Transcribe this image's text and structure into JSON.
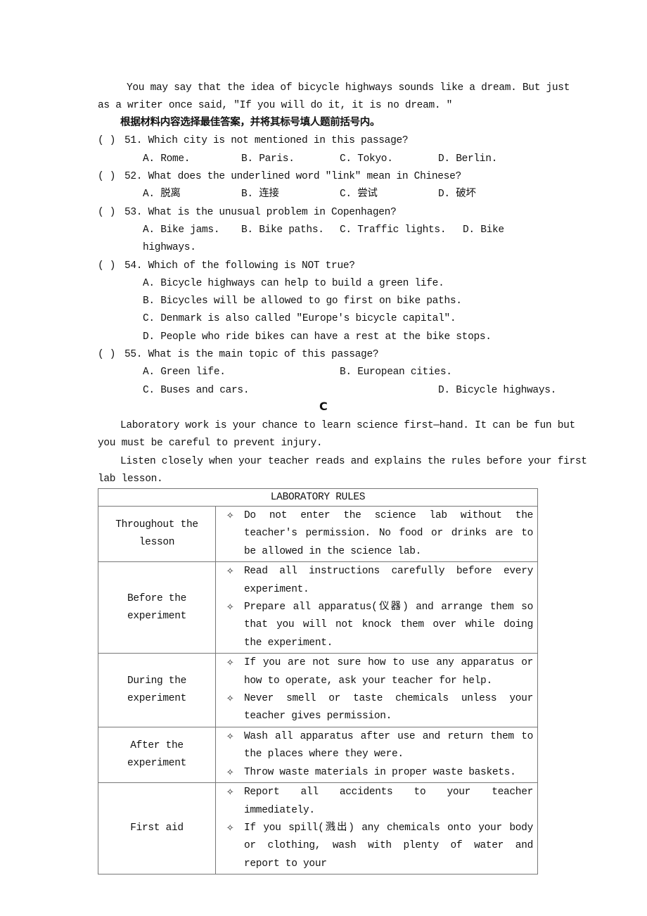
{
  "passage_end": {
    "line1": "You may say that the idea of bicycle highways sounds like a dream. But just",
    "line2": "as a writer once said, \"If you will do it, it is no dream. \""
  },
  "instructions": "根据材料内容选择最佳答案，并将其标号填人题前括号内。",
  "questions": [
    {
      "blank": "(    )",
      "stem": "51. Which city is not mentioned in this passage?",
      "options": [
        "A. Rome.",
        "B. Paris.",
        "C. Tokyo.",
        "D. Berlin."
      ]
    },
    {
      "blank": "(    )",
      "stem": "52. What does the underlined word \"link\" mean in Chinese?",
      "options": [
        "A. 脱离",
        "B. 连接",
        "C. 尝试",
        "D. 破坏"
      ]
    },
    {
      "blank": "(    )",
      "stem": "53. What is the unusual problem in Copenhagen?",
      "options": [
        "A. Bike jams.",
        "B. Bike paths.",
        "C. Traffic lights.",
        "D. Bike"
      ],
      "option_continuation": "highways."
    },
    {
      "blank": "(    )",
      "stem": "54. Which of the following is NOT true?",
      "options": [
        "A. Bicycle highways can help to build a green life.",
        "B. Bicycles will be allowed to go first on bike paths.",
        "C. Denmark is also called \"Europe's bicycle capital\".",
        "D. People who ride bikes can have a rest at the bike stops."
      ]
    },
    {
      "blank": "(    )",
      "stem": "55. What is the main topic of this passage?",
      "options": [
        "A. Green life.",
        "B. European cities.",
        "C. Buses and cars.",
        "D. Bicycle highways."
      ]
    }
  ],
  "section_c": {
    "heading": "C",
    "para1_line1": "Laboratory work is your chance to learn science first—hand. It can be fun but",
    "para1_line2": "you must be careful to prevent injury.",
    "para2_line1": "Listen closely when your teacher reads and explains the rules before your first",
    "para2_line2": "lab lesson."
  },
  "table": {
    "title": "LABORATORY RULES",
    "bullet_icon": "✧",
    "rows": [
      {
        "phase": [
          "Throughout the",
          "lesson"
        ],
        "rules": [
          "Do not enter the science lab without the teacher's permission. No food or drinks are to be allowed in the science lab."
        ]
      },
      {
        "phase": [
          "Before the",
          "experiment"
        ],
        "rules": [
          "Read all instructions carefully before every experiment.",
          "Prepare all apparatus(仪器) and arrange them so that you will not knock them over while doing the experiment."
        ]
      },
      {
        "phase": [
          "During the",
          "experiment"
        ],
        "rules": [
          "If you are not sure how to use any apparatus or how to operate, ask your teacher for help.",
          "Never smell or taste chemicals unless your teacher gives permission."
        ]
      },
      {
        "phase": [
          "After the",
          "experiment"
        ],
        "rules": [
          "Wash all apparatus after use and return them to the places where they were.",
          "Throw waste materials in proper waste baskets."
        ]
      },
      {
        "phase": [
          "First aid"
        ],
        "rules": [
          "Report all accidents to your teacher immediately.",
          "If you spill(溅出) any chemicals onto your body or clothing, wash with plenty of water and report to your"
        ]
      }
    ]
  }
}
